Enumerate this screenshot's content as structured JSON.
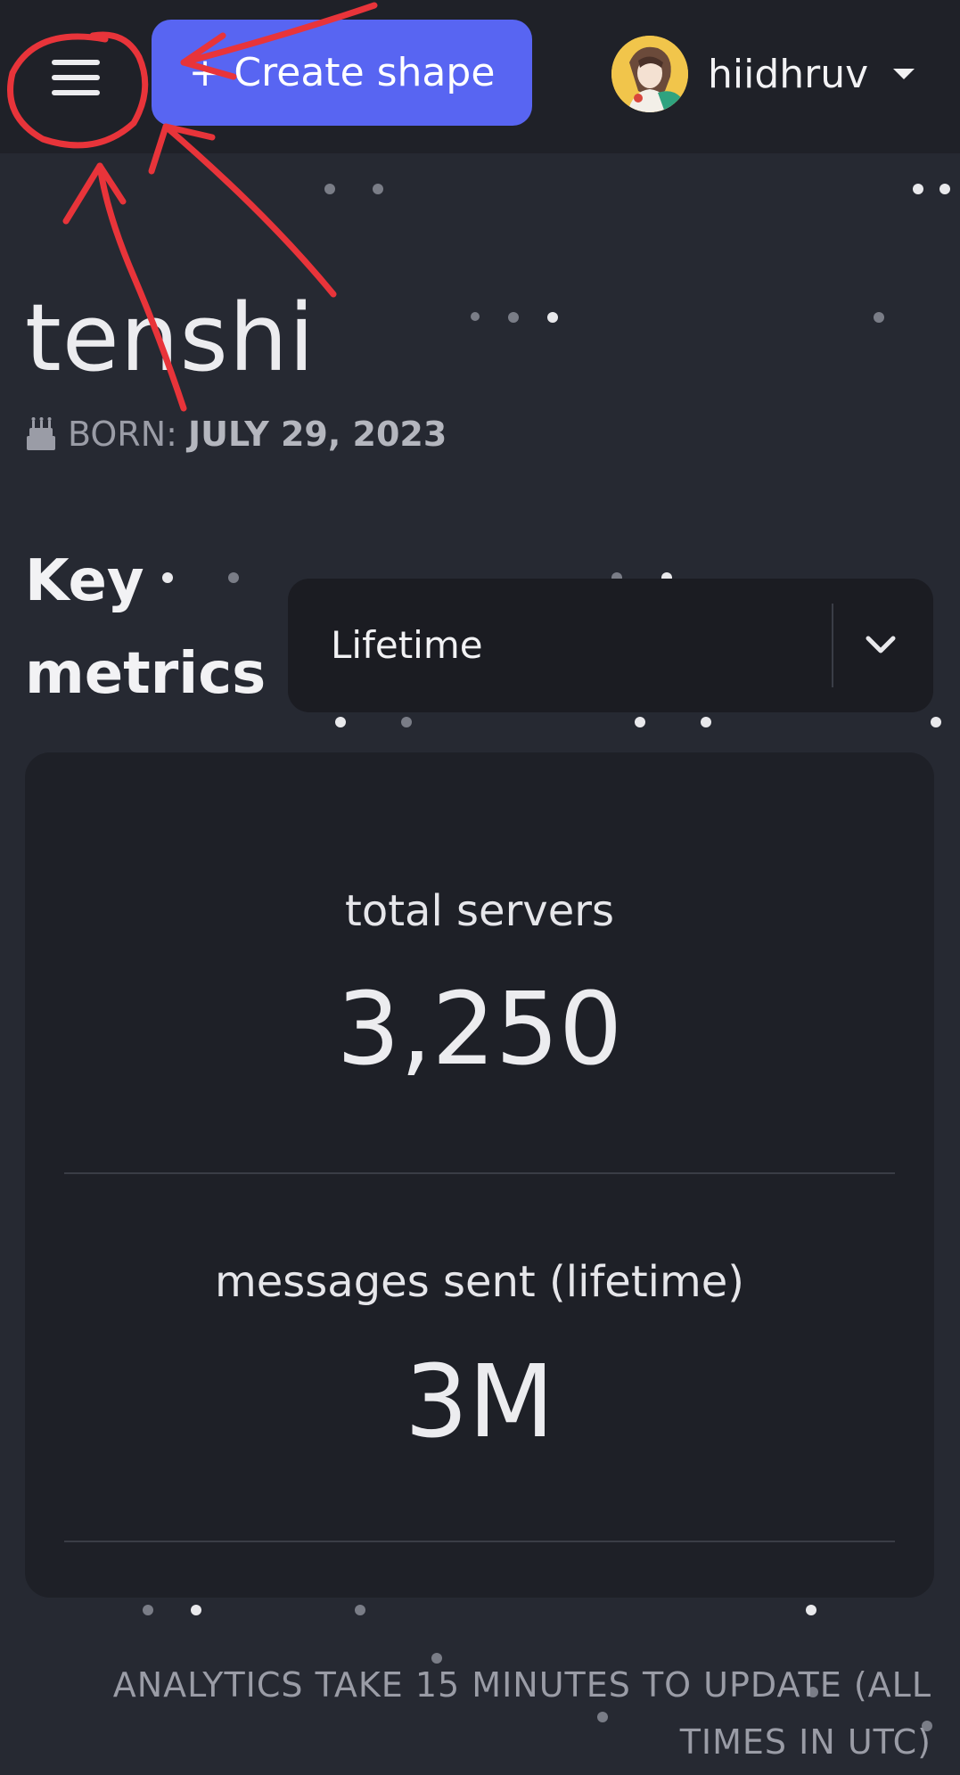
{
  "header": {
    "create_button_label": "+ Create shape",
    "username": "hiidhruv",
    "menu_icon": "hamburger-menu-icon",
    "dropdown_icon": "caret-down-icon"
  },
  "profile": {
    "name": "tenshi",
    "born_label": "BORN:",
    "born_date": "JULY 29, 2023",
    "born_icon": "birthday-cake-icon"
  },
  "metrics": {
    "title_line1": "Key",
    "title_line2": "metrics",
    "period_select": {
      "value": "Lifetime",
      "icon": "chevron-down-icon"
    },
    "items": [
      {
        "label": "total servers",
        "value": "3,250"
      },
      {
        "label": "messages sent (lifetime)",
        "value": "3M"
      }
    ]
  },
  "footnote_line1": "ANALYTICS TAKE 15 MINUTES TO UPDATE (ALL",
  "footnote_line2": "TIMES IN UTC)",
  "colors": {
    "background": "#262932",
    "topbar": "#1f2128",
    "accent": "#5865f2",
    "card": "#1e2027",
    "annotation": "#e8343a"
  }
}
